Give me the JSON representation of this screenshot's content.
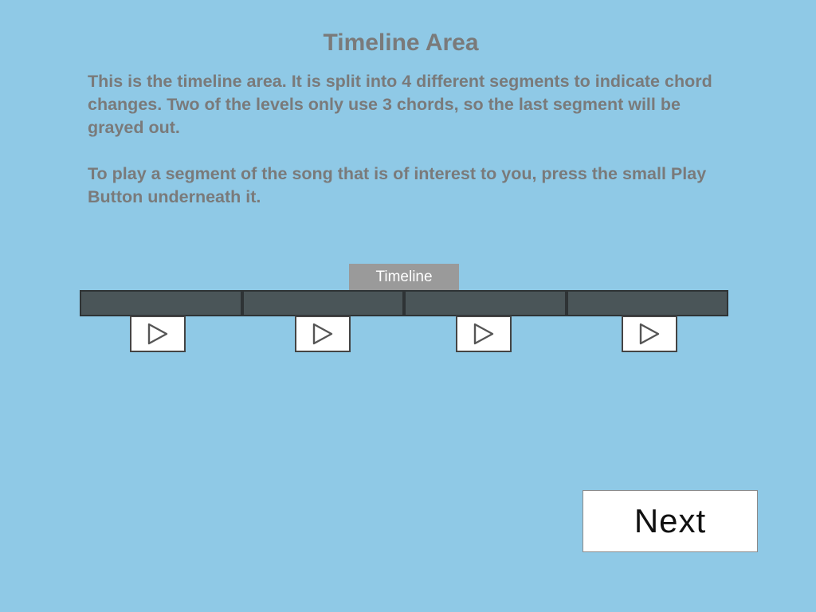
{
  "title": "Timeline Area",
  "description": {
    "paragraph1": "This is the timeline area. It is split into 4 different segments to indicate chord changes. Two of the levels only use 3 chords, so the last segment will be grayed out.",
    "paragraph2": "To play a segment of the song that is of interest to you, press the small Play Button underneath it."
  },
  "timeline": {
    "label": "Timeline",
    "segment_count": 4
  },
  "play_buttons": [
    {
      "icon": "play-icon"
    },
    {
      "icon": "play-icon"
    },
    {
      "icon": "play-icon"
    },
    {
      "icon": "play-icon"
    }
  ],
  "next_label": "Next",
  "colors": {
    "background": "#8fc9e6",
    "text_gray": "#7a7a7a",
    "timeline_segment": "#4a5558",
    "timeline_tab": "#9a9a9a"
  }
}
